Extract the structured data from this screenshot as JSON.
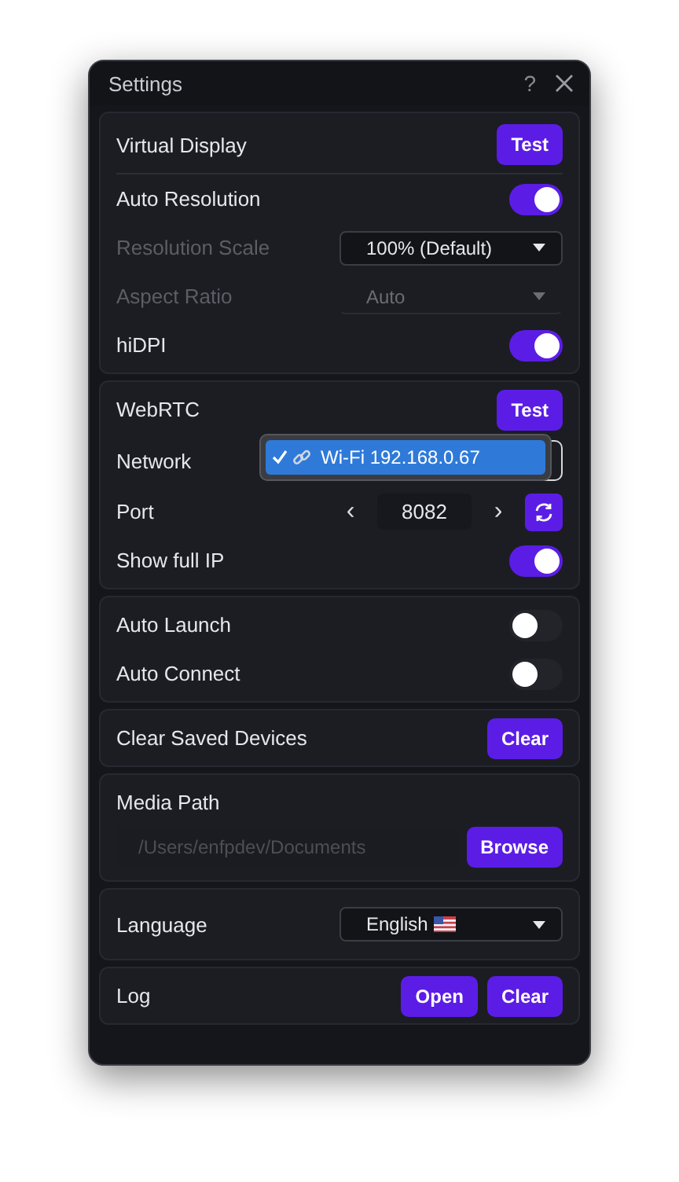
{
  "window": {
    "title": "Settings",
    "help": "?"
  },
  "sections": [
    {
      "rows": [
        {
          "kind": "button",
          "label": "Virtual Display",
          "buttons": [
            "Test"
          ],
          "divider": true
        },
        {
          "kind": "toggle",
          "label": "Auto Resolution",
          "on": true
        },
        {
          "kind": "select",
          "label": "Resolution Scale",
          "disabled": true,
          "select": {
            "value": "100% (Default)",
            "disabled": false
          }
        },
        {
          "kind": "select",
          "label": "Aspect Ratio",
          "disabled": true,
          "select": {
            "value": "Auto",
            "disabled": true
          }
        },
        {
          "kind": "toggle",
          "label": "hiDPI",
          "on": true
        }
      ]
    },
    {
      "rows": [
        {
          "kind": "button",
          "label": "WebRTC",
          "buttons": [
            "Test"
          ]
        },
        {
          "kind": "network",
          "label": "Network",
          "menu": [
            {
              "label": "Wi-Fi 192.168.0.67",
              "selected": true
            }
          ]
        },
        {
          "kind": "port",
          "label": "Port",
          "prev": "‹",
          "value": "8082",
          "next": "›"
        },
        {
          "kind": "toggle",
          "label": "Show full IP",
          "on": true
        }
      ]
    },
    {
      "rows": [
        {
          "kind": "toggle",
          "label": "Auto Launch",
          "on": false
        },
        {
          "kind": "toggle",
          "label": "Auto Connect",
          "on": false
        }
      ]
    },
    {
      "rows": [
        {
          "kind": "button",
          "label": "Clear Saved Devices",
          "buttons": [
            "Clear"
          ]
        }
      ]
    },
    {
      "rows": [
        {
          "kind": "path",
          "label": "Media Path",
          "placeholder": "/Users/enfpdev/Documents",
          "buttons": [
            "Browse"
          ]
        }
      ]
    },
    {
      "rows": [
        {
          "kind": "language",
          "label": "Language",
          "select": {
            "value": "English"
          }
        }
      ]
    },
    {
      "rows": [
        {
          "kind": "button",
          "label": "Log",
          "buttons": [
            "Open",
            "Clear"
          ]
        }
      ]
    }
  ]
}
